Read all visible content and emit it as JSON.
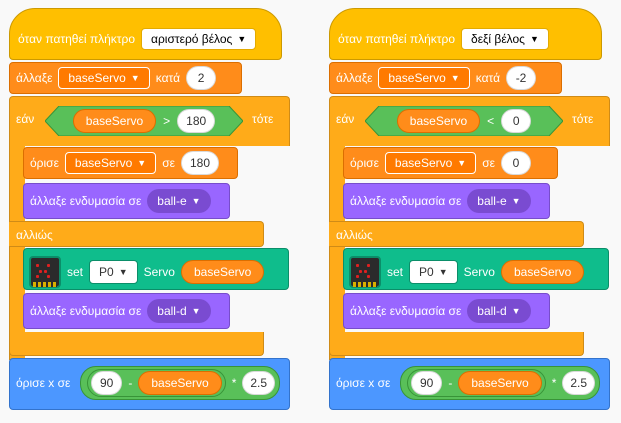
{
  "scripts": [
    {
      "hat": {
        "text": "όταν πατηθεί πλήκτρο",
        "key": "αριστερό βέλος"
      },
      "change": {
        "text": "άλλαξε",
        "var": "baseServo",
        "by_text": "κατά",
        "value": "2"
      },
      "if": {
        "if_text": "εάν",
        "then_text": "τότε",
        "else_text": "αλλιώς",
        "cond_var": "baseServo",
        "cond_op": ">",
        "cond_value": "180"
      },
      "set_var": {
        "text": "όρισε",
        "var": "baseServo",
        "to_text": "σε",
        "value": "180"
      },
      "costume1": {
        "text": "άλλαξε ενδυμασία σε",
        "value": "ball-e"
      },
      "servo": {
        "set_text": "set",
        "pin": "P0",
        "servo_text": "Servo",
        "var": "baseServo"
      },
      "costume2": {
        "text": "άλλαξε ενδυμασία σε",
        "value": "ball-d"
      },
      "setx": {
        "text": "όρισε x σε",
        "a": "90",
        "minus": "-",
        "var": "baseServo",
        "times": "*",
        "b": "2.5"
      }
    },
    {
      "hat": {
        "text": "όταν πατηθεί πλήκτρο",
        "key": "δεξί βέλος"
      },
      "change": {
        "text": "άλλαξε",
        "var": "baseServo",
        "by_text": "κατά",
        "value": "-2"
      },
      "if": {
        "if_text": "εάν",
        "then_text": "τότε",
        "else_text": "αλλιώς",
        "cond_var": "baseServo",
        "cond_op": "<",
        "cond_value": "0"
      },
      "set_var": {
        "text": "όρισε",
        "var": "baseServo",
        "to_text": "σε",
        "value": "0"
      },
      "costume1": {
        "text": "άλλαξε ενδυμασία σε",
        "value": "ball-e"
      },
      "servo": {
        "set_text": "set",
        "pin": "P0",
        "servo_text": "Servo",
        "var": "baseServo"
      },
      "costume2": {
        "text": "άλλαξε ενδυμασία σε",
        "value": "ball-d"
      },
      "setx": {
        "text": "όρισε x σε",
        "a": "90",
        "minus": "-",
        "var": "baseServo",
        "times": "*",
        "b": "2.5"
      }
    }
  ],
  "colors": {
    "events": "#ffbf00",
    "control": "#ffab19",
    "variables": "#ff8c1a",
    "looks": "#9966ff",
    "extension": "#0fbd8c",
    "motion": "#4c97ff",
    "operators": "#59c059"
  }
}
